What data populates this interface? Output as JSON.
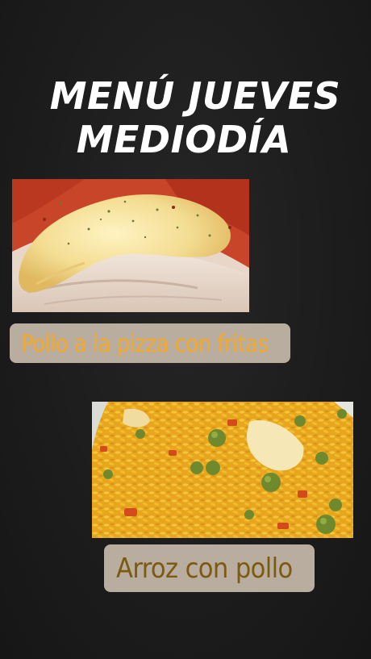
{
  "title": {
    "line1": "MENÚ JUEVES",
    "line2": "MEDIODÍA"
  },
  "dishes": [
    {
      "name": "Pollo a la pizza con fritas",
      "photo": "chicken-pizza-photo"
    },
    {
      "name": "Arroz con pollo",
      "photo": "rice-with-chicken-photo"
    }
  ]
}
